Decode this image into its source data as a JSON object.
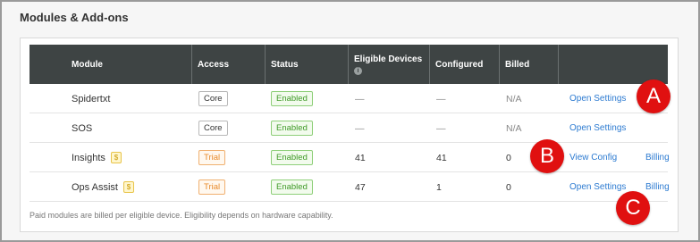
{
  "page": {
    "title": "Modules & Add-ons"
  },
  "table": {
    "headers": {
      "module": "Module",
      "access": "Access",
      "status": "Status",
      "eligible": "Eligible Devices",
      "configured": "Configured",
      "billed": "Billed"
    },
    "info_icon": "info-icon",
    "rows": [
      {
        "module": "Spidertxt",
        "paid": false,
        "access": "Core",
        "status": "Enabled",
        "eligible": "—",
        "configured": "—",
        "billed": "N/A",
        "action1": "Open Settings",
        "action2": ""
      },
      {
        "module": "SOS",
        "paid": false,
        "access": "Core",
        "status": "Enabled",
        "eligible": "—",
        "configured": "—",
        "billed": "N/A",
        "action1": "Open Settings",
        "action2": ""
      },
      {
        "module": "Insights",
        "paid": true,
        "dollar": "$",
        "access": "Trial",
        "status": "Enabled",
        "eligible": "41",
        "configured": "41",
        "billed": "0",
        "action1": "View Config",
        "action2": "Billing"
      },
      {
        "module": "Ops Assist",
        "paid": true,
        "dollar": "$",
        "access": "Trial",
        "status": "Enabled",
        "eligible": "47",
        "configured": "1",
        "billed": "0",
        "action1": "Open Settings",
        "action2": "Billing"
      }
    ]
  },
  "footnote": "Paid modules are billed per eligible device. Eligibility depends on hardware capability.",
  "markers": {
    "a": "A",
    "b": "B",
    "c": "C"
  },
  "colors": {
    "header_bg": "#3e4444",
    "link": "#2d7bd1",
    "enabled": "#3f9a27",
    "trial": "#e88a2a",
    "marker": "#e01010"
  }
}
